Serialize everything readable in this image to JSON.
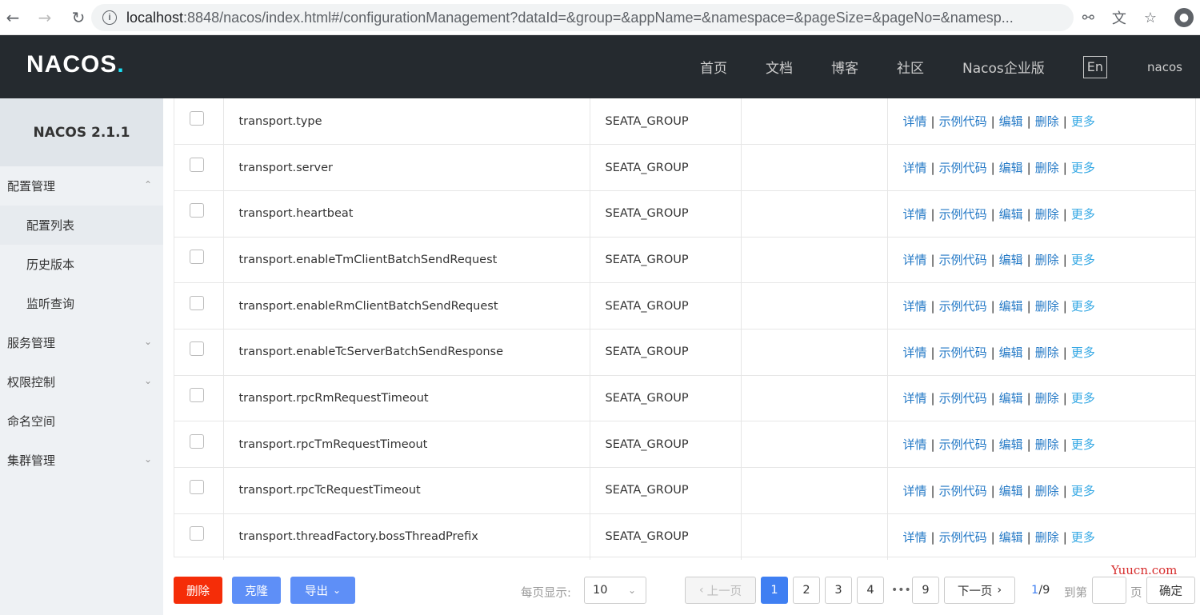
{
  "browser": {
    "url_host": "localhost",
    "url_rest": ":8848/nacos/index.html#/configurationManagement?dataId=&group=&appName=&namespace=&pageSize=&pageNo=&namesp..."
  },
  "header": {
    "logo": "NACOS",
    "nav": [
      "首页",
      "文档",
      "博客",
      "社区",
      "Nacos企业版"
    ],
    "lang": "En",
    "user": "nacos"
  },
  "sidebar": {
    "version": "NACOS 2.1.1",
    "config_group": "配置管理",
    "config_items": [
      "配置列表",
      "历史版本",
      "监听查询"
    ],
    "service": "服务管理",
    "auth": "权限控制",
    "namespace": "命名空间",
    "cluster": "集群管理"
  },
  "table": {
    "rows": [
      {
        "data_id": "transport.type",
        "group": "SEATA_GROUP",
        "app": ""
      },
      {
        "data_id": "transport.server",
        "group": "SEATA_GROUP",
        "app": ""
      },
      {
        "data_id": "transport.heartbeat",
        "group": "SEATA_GROUP",
        "app": ""
      },
      {
        "data_id": "transport.enableTmClientBatchSendRequest",
        "group": "SEATA_GROUP",
        "app": ""
      },
      {
        "data_id": "transport.enableRmClientBatchSendRequest",
        "group": "SEATA_GROUP",
        "app": ""
      },
      {
        "data_id": "transport.enableTcServerBatchSendResponse",
        "group": "SEATA_GROUP",
        "app": ""
      },
      {
        "data_id": "transport.rpcRmRequestTimeout",
        "group": "SEATA_GROUP",
        "app": ""
      },
      {
        "data_id": "transport.rpcTmRequestTimeout",
        "group": "SEATA_GROUP",
        "app": ""
      },
      {
        "data_id": "transport.rpcTcRequestTimeout",
        "group": "SEATA_GROUP",
        "app": ""
      },
      {
        "data_id": "transport.threadFactory.bossThreadPrefix",
        "group": "SEATA_GROUP",
        "app": ""
      }
    ],
    "ops": {
      "detail": "详情",
      "sample": "示例代码",
      "edit": "编辑",
      "delete": "删除",
      "more": "更多"
    },
    "separator": "|"
  },
  "footer": {
    "delete_label": "删除",
    "clone_label": "克隆",
    "export_label": "导出",
    "page_size_label": "每页显示:",
    "page_size": "10",
    "prev_label": "上一页",
    "pages": [
      "1",
      "2",
      "3",
      "4"
    ],
    "ellipsis": "•••",
    "last_page": "9",
    "next_label": "下一页",
    "current": "1",
    "total": "/9",
    "goto_label": "到第",
    "goto_page_suffix": "页",
    "confirm_label": "确定"
  },
  "watermark": "Yuucn.com"
}
